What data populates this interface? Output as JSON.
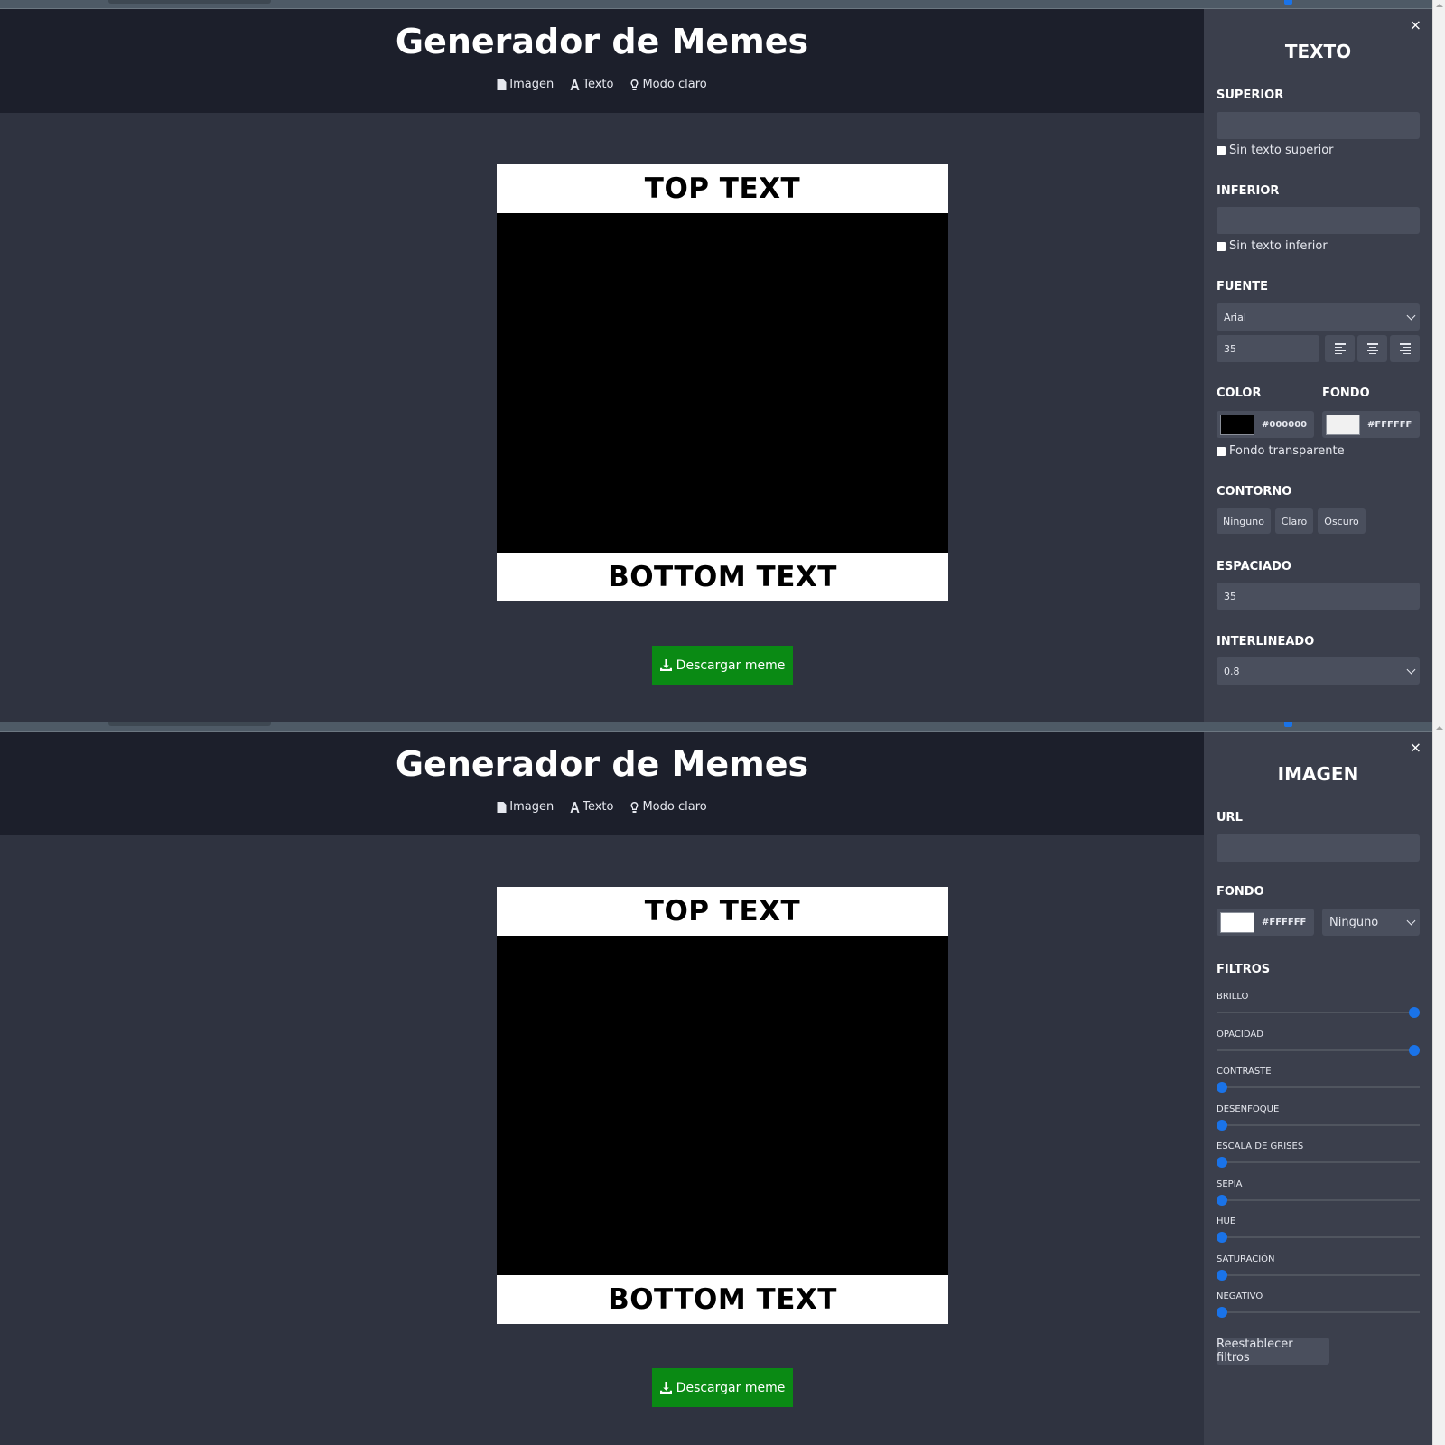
{
  "app": {
    "title": "Generador de Memes",
    "nav": [
      "Imagen",
      "Texto",
      "Modo claro"
    ],
    "download_label": "Descargar meme"
  },
  "meme": {
    "top_text": "TOP TEXT",
    "bottom_text": "BOTTOM TEXT"
  },
  "text_panel": {
    "close": "×",
    "title": "TEXTO",
    "superior_label": "SUPERIOR",
    "superior_value": "",
    "no_top_label": "Sin texto superior",
    "inferior_label": "INFERIOR",
    "inferior_value": "",
    "no_bottom_label": "Sin texto inferior",
    "font_label": "FUENTE",
    "font_value": "Arial",
    "size_value": "35",
    "color_label": "COLOR",
    "color_value": "#000000",
    "bg_label": "FONDO",
    "bg_value": "#FFFFFF",
    "transparent_label": "Fondo transparente",
    "outline_label": "CONTORNO",
    "outline_options": [
      "Ninguno",
      "Claro",
      "Oscuro"
    ],
    "spacing_label": "ESPACIADO",
    "spacing_value": "35",
    "line_height_label": "INTERLINEADO",
    "line_height_value": "0.8"
  },
  "image_panel": {
    "close": "×",
    "title": "IMAGEN",
    "url_label": "URL",
    "url_value": "",
    "bg_label": "FONDO",
    "bg_value": "#FFFFFF",
    "blend_value": "Ninguno",
    "filters_label": "FILTROS",
    "filters": [
      {
        "label": "BRILLO",
        "level": 1
      },
      {
        "label": "OPACIDAD",
        "level": 1
      },
      {
        "label": "CONTRASTE",
        "level": 0
      },
      {
        "label": "DESENFOQUE",
        "level": 0
      },
      {
        "label": "ESCALA DE GRISES",
        "level": 0
      },
      {
        "label": "SEPIA",
        "level": 0
      },
      {
        "label": "HUE",
        "level": 0
      },
      {
        "label": "SATURACIÓN",
        "level": 0
      },
      {
        "label": "NEGATIVO",
        "level": 0
      }
    ],
    "reset_label": "Reestablecer filtros"
  },
  "colors": {
    "header_bg": "#1c1f2b",
    "canvas_bg": "#2f3340",
    "panel_bg": "#3b3f4c",
    "download_green": "#0a8a14",
    "slider_blue": "#1a73e8"
  },
  "icons": [
    "file-image-icon",
    "font-icon",
    "lightbulb-icon",
    "download-icon",
    "align-left-icon",
    "align-center-icon",
    "align-right-icon",
    "close-icon"
  ]
}
